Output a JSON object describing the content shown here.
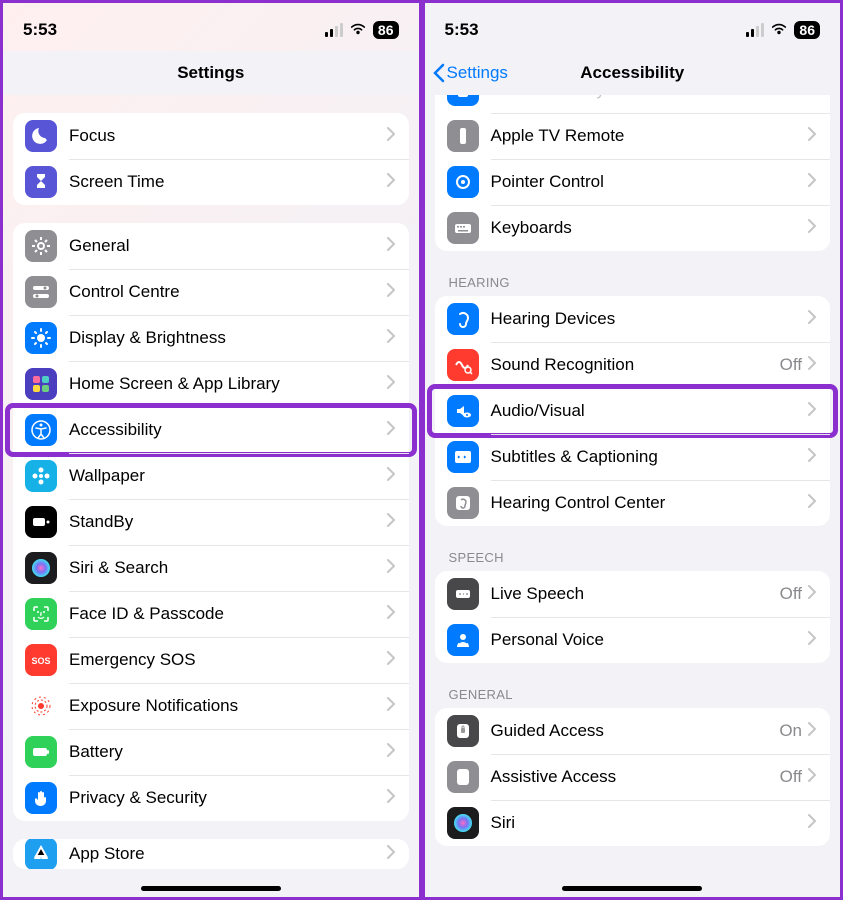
{
  "status": {
    "time": "5:53",
    "battery": "86"
  },
  "left": {
    "title": "Settings",
    "groups": [
      {
        "rows": [
          {
            "icon": "moon",
            "bg": "#5856d6",
            "label": "Focus"
          },
          {
            "icon": "hourglass",
            "bg": "#5856d6",
            "label": "Screen Time"
          }
        ]
      },
      {
        "rows": [
          {
            "icon": "gear",
            "bg": "#8e8e93",
            "label": "General"
          },
          {
            "icon": "switches",
            "bg": "#8e8e93",
            "label": "Control Centre"
          },
          {
            "icon": "sun",
            "bg": "#007aff",
            "label": "Display & Brightness"
          },
          {
            "icon": "apps",
            "bg": "#4b3fbf",
            "label": "Home Screen & App Library"
          },
          {
            "icon": "accessibility",
            "bg": "#007aff",
            "label": "Accessibility",
            "highlight": true
          },
          {
            "icon": "flower",
            "bg": "#16b1e7",
            "label": "Wallpaper"
          },
          {
            "icon": "standby",
            "bg": "#000000",
            "label": "StandBy"
          },
          {
            "icon": "siri",
            "bg": "#1c1c1e",
            "label": "Siri & Search"
          },
          {
            "icon": "faceid",
            "bg": "#30d158",
            "label": "Face ID & Passcode"
          },
          {
            "icon": "sos",
            "bg": "#ff3b30",
            "label": "Emergency SOS"
          },
          {
            "icon": "exposure",
            "bg": "#ffffff",
            "label": "Exposure Notifications",
            "fg": "#ff3b30"
          },
          {
            "icon": "battery",
            "bg": "#30d158",
            "label": "Battery"
          },
          {
            "icon": "hand",
            "bg": "#007aff",
            "label": "Privacy & Security"
          }
        ]
      },
      {
        "rows": [
          {
            "icon": "appstore",
            "bg": "#1e9ff0",
            "label": "App Store",
            "partial": true
          }
        ]
      }
    ]
  },
  "right": {
    "back": "Settings",
    "title": "Accessibility",
    "groups": [
      {
        "cutTop": true,
        "rows": [
          {
            "icon": "control-nearby",
            "bg": "#007aff",
            "label": "Control Nearby Devices",
            "faded": true
          },
          {
            "icon": "remote",
            "bg": "#8e8e93",
            "label": "Apple TV Remote"
          },
          {
            "icon": "pointer",
            "bg": "#007aff",
            "label": "Pointer Control"
          },
          {
            "icon": "keyboard",
            "bg": "#8e8e93",
            "label": "Keyboards"
          }
        ]
      },
      {
        "header": "Hearing",
        "rows": [
          {
            "icon": "ear",
            "bg": "#007aff",
            "label": "Hearing Devices"
          },
          {
            "icon": "sound-rec",
            "bg": "#ff3b30",
            "label": "Sound Recognition",
            "value": "Off"
          },
          {
            "icon": "audio-visual",
            "bg": "#007aff",
            "label": "Audio/Visual",
            "highlight": true
          },
          {
            "icon": "captions",
            "bg": "#007aff",
            "label": "Subtitles & Captioning"
          },
          {
            "icon": "hearing-ctrl",
            "bg": "#8e8e93",
            "label": "Hearing Control Center"
          }
        ]
      },
      {
        "header": "Speech",
        "rows": [
          {
            "icon": "live-speech",
            "bg": "#48484a",
            "label": "Live Speech",
            "value": "Off"
          },
          {
            "icon": "personal-voice",
            "bg": "#007aff",
            "label": "Personal Voice"
          }
        ]
      },
      {
        "header": "General",
        "rows": [
          {
            "icon": "guided",
            "bg": "#48484a",
            "label": "Guided Access",
            "value": "On"
          },
          {
            "icon": "assistive",
            "bg": "#8e8e93",
            "label": "Assistive Access",
            "value": "Off"
          },
          {
            "icon": "siri",
            "bg": "#1c1c1e",
            "label": "Siri"
          }
        ]
      }
    ]
  }
}
